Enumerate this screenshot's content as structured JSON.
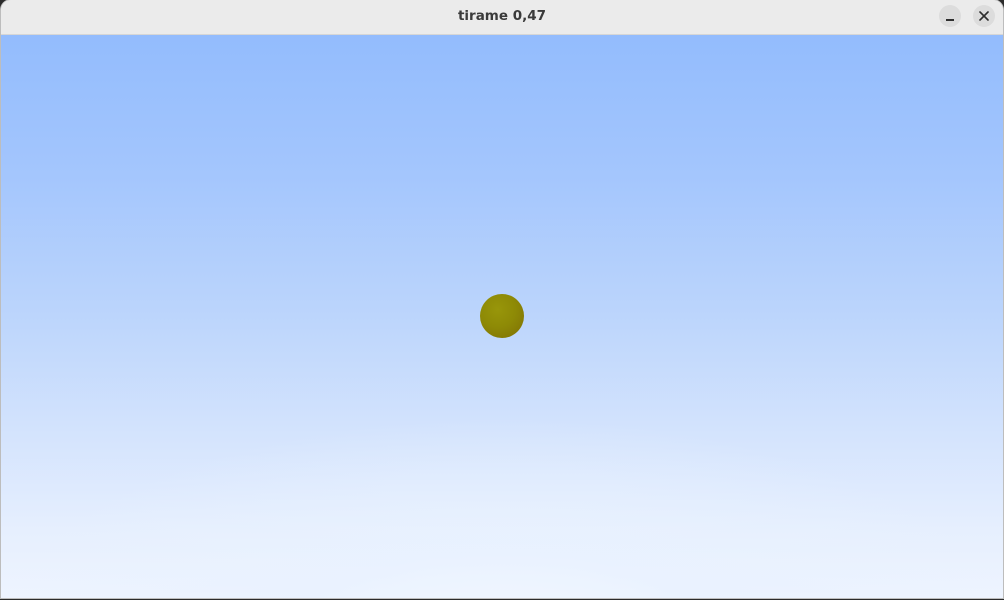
{
  "window": {
    "title": "tirame 0,47"
  },
  "controls": {
    "minimize_icon": "minimize-icon",
    "close_icon": "close-icon"
  },
  "scene": {
    "sky_top_color": "#93bcfd",
    "sky_bottom_color": "#eef4ff",
    "ball_color": "#8e8a06"
  }
}
